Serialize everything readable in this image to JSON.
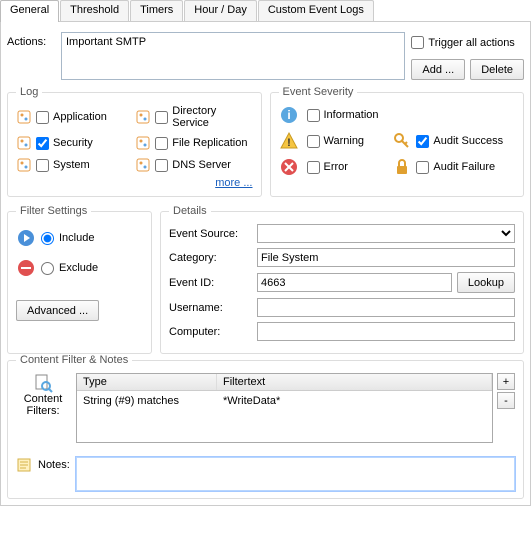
{
  "tabs": {
    "general": "General",
    "threshold": "Threshold",
    "timers": "Timers",
    "hourday": "Hour / Day",
    "custom": "Custom Event Logs"
  },
  "actions": {
    "label": "Actions:",
    "value": "Important SMTP",
    "trigger_all": "Trigger all actions",
    "add": "Add ...",
    "delete": "Delete"
  },
  "log": {
    "legend": "Log",
    "application": "Application",
    "security": "Security",
    "system": "System",
    "directory": "Directory Service",
    "replication": "File Replication",
    "dns": "DNS Server",
    "more": "more ...",
    "checked": {
      "application": false,
      "security": true,
      "system": false,
      "directory": false,
      "replication": false,
      "dns": false
    }
  },
  "severity": {
    "legend": "Event Severity",
    "information": "Information",
    "warning": "Warning",
    "error": "Error",
    "audit_success": "Audit Success",
    "audit_failure": "Audit Failure",
    "checked": {
      "information": false,
      "warning": false,
      "error": false,
      "audit_success": true,
      "audit_failure": false
    }
  },
  "filter": {
    "legend": "Filter Settings",
    "include": "Include",
    "exclude": "Exclude",
    "advanced": "Advanced ...",
    "selected": "include"
  },
  "details": {
    "legend": "Details",
    "event_source_label": "Event Source:",
    "event_source": "",
    "category_label": "Category:",
    "category": "File System",
    "event_id_label": "Event ID:",
    "event_id": "4663",
    "lookup": "Lookup",
    "username_label": "Username:",
    "username": "",
    "computer_label": "Computer:",
    "computer": ""
  },
  "content": {
    "legend": "Content Filter & Notes",
    "filters_label": "Content Filters:",
    "header_type": "Type",
    "header_filtertext": "Filtertext",
    "rows": [
      {
        "type": "String (#9) matches",
        "text": "*WriteData*"
      }
    ],
    "add": "+",
    "remove": "-",
    "notes_label": "Notes:",
    "notes": ""
  }
}
